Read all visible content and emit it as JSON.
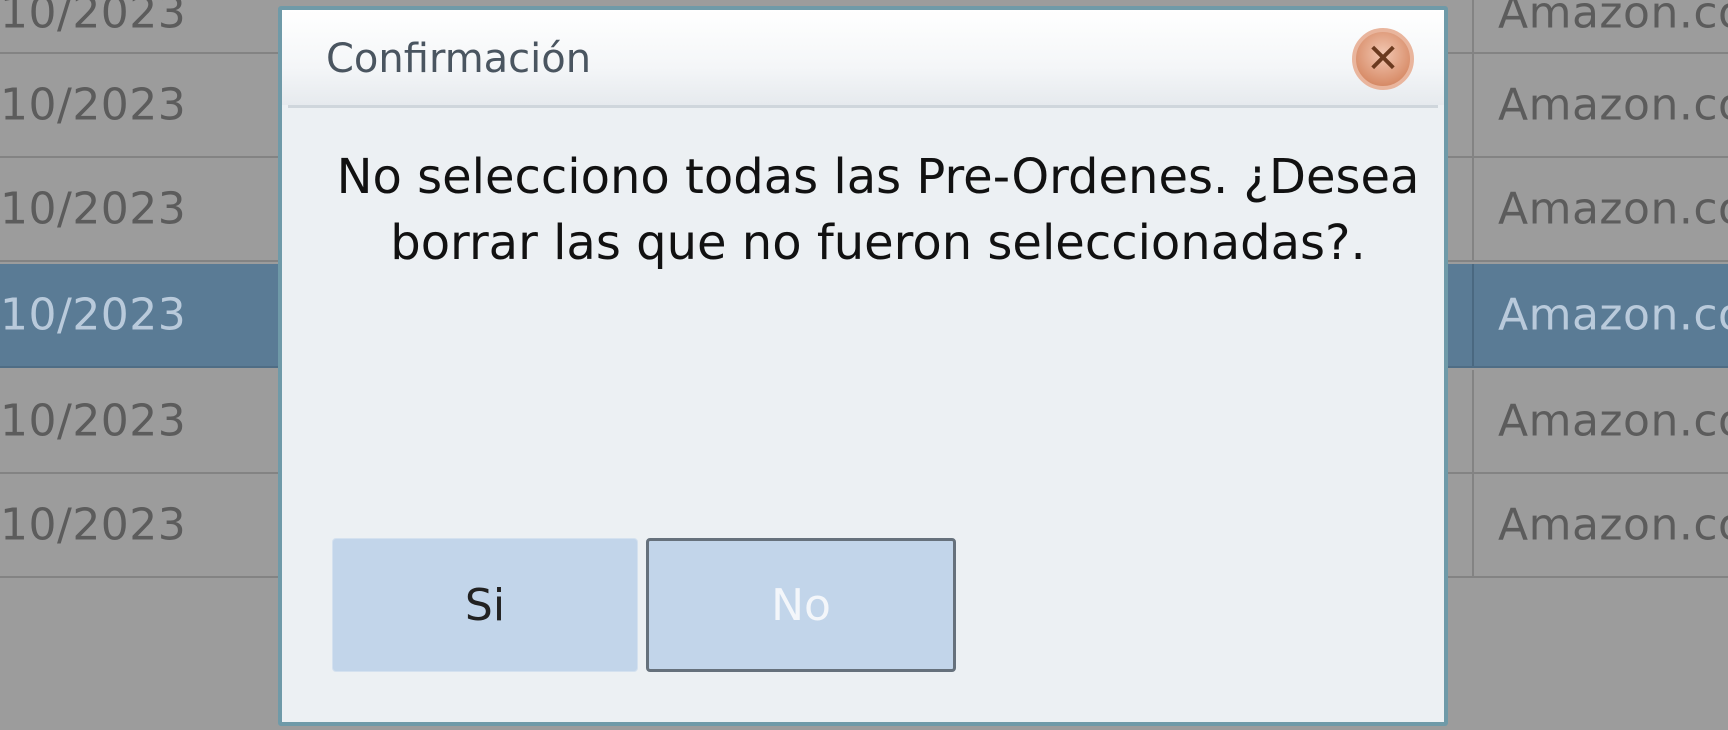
{
  "background_table": {
    "rows": [
      {
        "date": "10/2023",
        "store": "Amazon.co",
        "selected": false
      },
      {
        "date": "10/2023",
        "store": "Amazon.co",
        "selected": false
      },
      {
        "date": "10/2023",
        "store": "Amazon.co",
        "selected": true
      },
      {
        "date": "10/2023",
        "store": "Amazon.co",
        "selected": false
      },
      {
        "date": "10/2023",
        "store": "Amazon.co",
        "selected": false
      }
    ],
    "top_partial": {
      "date": "10/2023",
      "store": "Amazon.co"
    }
  },
  "dialog": {
    "title": "Confirmación",
    "close_icon": "close-icon",
    "message": "No selecciono todas las Pre-Ordenes. ¿Desea borrar las que no fueron seleccionadas?.",
    "buttons": {
      "yes": "Si",
      "no": "No"
    }
  },
  "colors": {
    "overlay": "#9c9c9c",
    "selected_row": "#5a7b95",
    "dialog_border": "#6f9aa8",
    "button": "#c2d5ea"
  }
}
